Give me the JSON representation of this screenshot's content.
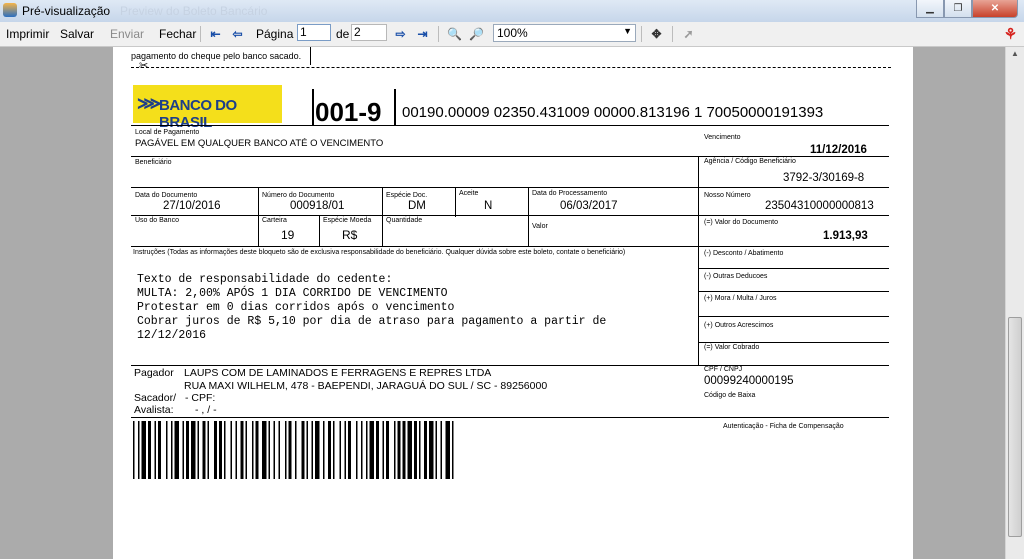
{
  "window": {
    "title": "Pré-visualização",
    "ghost_title": "Preview do Boleto Bancário"
  },
  "toolbar": {
    "print": "Imprimir",
    "save": "Salvar",
    "send": "Enviar",
    "close": "Fechar",
    "page_label": "Página",
    "page_value": "1",
    "of_label": "de",
    "total_pages": "2",
    "zoom": "100%"
  },
  "boleto": {
    "previous_line": "pagamento do cheque pelo banco sacado.",
    "bank_logo_text": "BANCO DO BRASIL",
    "bank_code": "001-9",
    "digitable_line": "00190.00009 02350.431009 00000.813196 1 70050000191393",
    "local_pagamento_label": "Local de Pagamento",
    "local_pagamento": "PAGÁVEL EM QUALQUER BANCO ATÉ O VENCIMENTO",
    "vencimento_label": "Vencimento",
    "vencimento": "11/12/2016",
    "beneficiario_label": "Beneficiário",
    "agencia_label": "Agência / Código Beneficiário",
    "agencia": "3792-3/30169-8",
    "data_documento_label": "Data do Documento",
    "data_documento": "27/10/2016",
    "numero_documento_label": "Número do Documento",
    "numero_documento": "000918/01",
    "especie_doc_label": "Espécie Doc.",
    "especie_doc": "DM",
    "aceite_label": "Aceite",
    "aceite": "N",
    "data_processamento_label": "Data do Processamento",
    "data_processamento": "06/03/2017",
    "nosso_numero_label": "Nosso Número",
    "nosso_numero": "23504310000000813",
    "uso_banco_label": "Uso do Banco",
    "carteira_label": "Carteira",
    "carteira": "19",
    "especie_moeda_label": "Espécie Moeda",
    "especie_moeda": "R$",
    "quantidade_label": "Quantidade",
    "valor_label": "Valor",
    "valor_documento_label": "(=) Valor do Documento",
    "valor_documento": "1.913,93",
    "instrucoes_label": "Instruções (Todas as informações deste bloqueto são de exclusiva responsabilidade do beneficiário. Qualquer dúvida sobre este boleto, contate o beneficiário)",
    "instrucoes": [
      "Texto de responsabilidade do cedente:",
      "MULTA: 2,00% APÓS 1 DIA CORRIDO DE VENCIMENTO",
      "Protestar em 0 dias corridos após o vencimento",
      "Cobrar juros de R$ 5,10 por dia de atraso para pagamento a partir de",
      "12/12/2016"
    ],
    "desconto_label": "(-) Desconto / Abatimento",
    "outras_deducoes_label": "(-) Outras Deducoes",
    "mora_label": "(+) Mora / Multa / Juros",
    "outros_acrescimos_label": "(+) Outros Acrescimos",
    "valor_cobrado_label": "(=) Valor Cobrado",
    "pagador_label": "Pagador",
    "pagador_nome": "LAUPS COM DE LAMINADOS E FERRAGENS E REPRES LTDA",
    "pagador_endereco": "RUA MAXI WILHELM, 478  - BAEPENDI, JARAGUÁ DO SUL / SC - 89256000",
    "sacador_label": "Sacador/",
    "sacador_value": "- CPF:",
    "avalista_label": "Avalista:",
    "avalista_value": "- , / -",
    "cpf_cnpj_label": "CPF / CNPJ",
    "cpf_cnpj": "00099240000195",
    "codigo_baixa_label": "Código de Baixa",
    "autenticacao_label": "Autenticação - Ficha de Compensação",
    "scissors": "✂"
  }
}
